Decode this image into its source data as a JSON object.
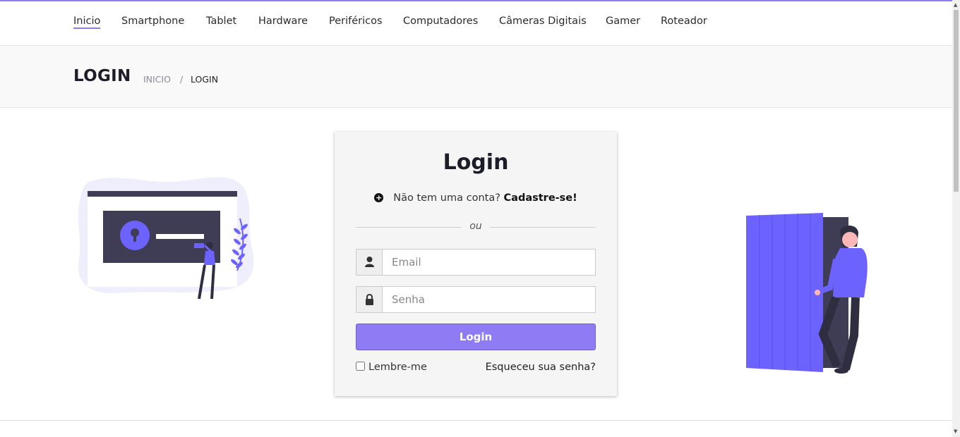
{
  "nav": {
    "items": [
      {
        "label": "Inicio",
        "active": true
      },
      {
        "label": "Smartphone"
      },
      {
        "label": "Tablet"
      },
      {
        "label": "Hardware"
      },
      {
        "label": "Periféricos"
      },
      {
        "label": "Computadores"
      },
      {
        "label": "Câmeras Digitais"
      },
      {
        "label": "Gamer"
      },
      {
        "label": "Roteador"
      }
    ]
  },
  "breadcrumb": {
    "title": "LOGIN",
    "home": "INICIO",
    "separator": "/",
    "current": "LOGIN"
  },
  "login": {
    "title": "Login",
    "no_account_text": "Não tem uma conta?",
    "signup_link": "Cadastre-se!",
    "divider_text": "ou",
    "email_placeholder": "Email",
    "password_placeholder": "Senha",
    "submit_label": "Login",
    "remember_label": "Lembre-me",
    "forgot_link": "Esqueceu sua senha?"
  },
  "icons": {
    "signup": "plus-circle-icon",
    "email": "user-icon",
    "password": "lock-icon"
  },
  "colors": {
    "accent": "#8f7cf4",
    "illustration_purple": "#6c63ff",
    "dark": "#3f3d56"
  }
}
